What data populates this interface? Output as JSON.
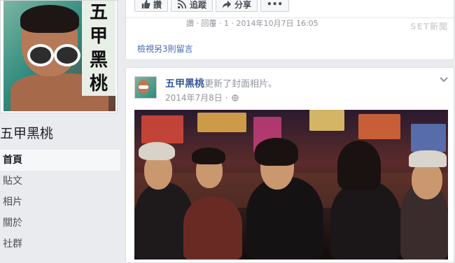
{
  "sidebar": {
    "profile_text": "五甲\n黑桃",
    "page_name": "五甲黑桃",
    "nav": [
      {
        "label": "首頁",
        "active": true
      },
      {
        "label": "貼文",
        "active": false
      },
      {
        "label": "相片",
        "active": false
      },
      {
        "label": "關於",
        "active": false
      },
      {
        "label": "社群",
        "active": false
      }
    ]
  },
  "prev_post": {
    "actions": {
      "like": "讚",
      "follow": "追蹤",
      "share": "分享",
      "more": "•••"
    },
    "comment_meta": "讚 · 回覆 · 1 · 2014年10月7日 16:05",
    "watermark": "SET新聞",
    "more_comments": "檢視另3則留言"
  },
  "post": {
    "author": "五甲黑桃",
    "action": "更新了封面相片。",
    "date": "2014年7月8日 ·"
  },
  "colors": {
    "background": "#e9ebee",
    "link": "#365899",
    "muted": "#90949c"
  }
}
